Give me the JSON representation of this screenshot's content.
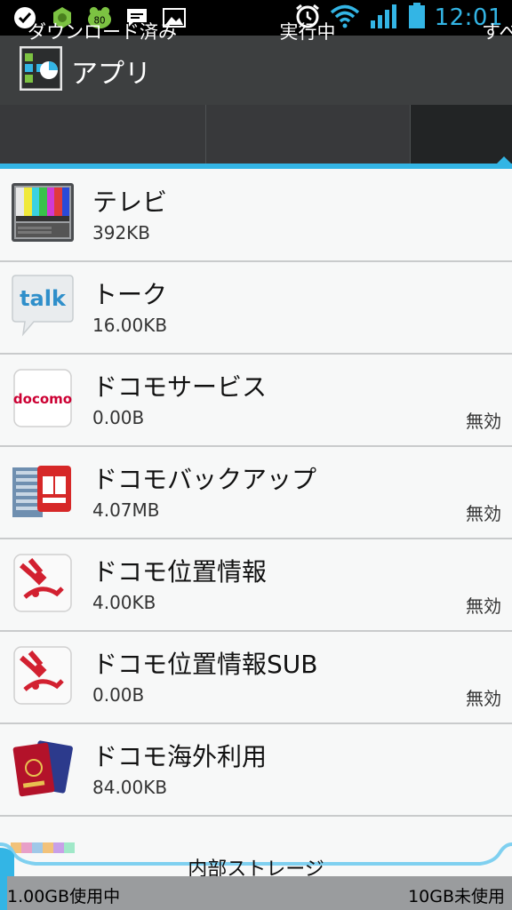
{
  "status_bar": {
    "time": "12:01",
    "notification_badge": "80",
    "icons": [
      "check-icon",
      "android-icon",
      "frog-icon",
      "chat-icon",
      "image-icon",
      "alarm-icon",
      "wifi-icon",
      "signal-icon",
      "battery-icon"
    ]
  },
  "action_bar": {
    "title": "アプリ"
  },
  "tabs": [
    {
      "label": "ダウンロード済み",
      "selected": false
    },
    {
      "label": "実行中",
      "selected": false
    },
    {
      "label": "すべ",
      "selected": true
    }
  ],
  "apps": [
    {
      "name": "テレビ",
      "size": "392KB",
      "status": "",
      "icon": "tv-icon"
    },
    {
      "name": "トーク",
      "size": "16.00KB",
      "status": "",
      "icon": "talk-icon"
    },
    {
      "name": "ドコモサービス",
      "size": "0.00B",
      "status": "無効",
      "icon": "docomo-icon"
    },
    {
      "name": "ドコモバックアップ",
      "size": "4.07MB",
      "status": "無効",
      "icon": "backup-icon"
    },
    {
      "name": "ドコモ位置情報",
      "size": "4.00KB",
      "status": "無効",
      "icon": "location-icon"
    },
    {
      "name": "ドコモ位置情報SUB",
      "size": "0.00B",
      "status": "無効",
      "icon": "location-sub-icon"
    },
    {
      "name": "ドコモ海外利用",
      "size": "84.00KB",
      "status": "",
      "icon": "passport-icon"
    },
    {
      "name": "",
      "size": "",
      "status": "",
      "icon": "partial-app-icon"
    }
  ],
  "talk_icon_text": "talk",
  "docomo_icon_text": "docomo",
  "storage": {
    "label": "内部ストレージ",
    "used": "1.00GB使用中",
    "free": "10GB未使用",
    "accent": "#33b5e5"
  },
  "colors": {
    "accent": "#33b5e5",
    "action_bar": "#3d3f40",
    "tab_bg": "#38393b"
  }
}
